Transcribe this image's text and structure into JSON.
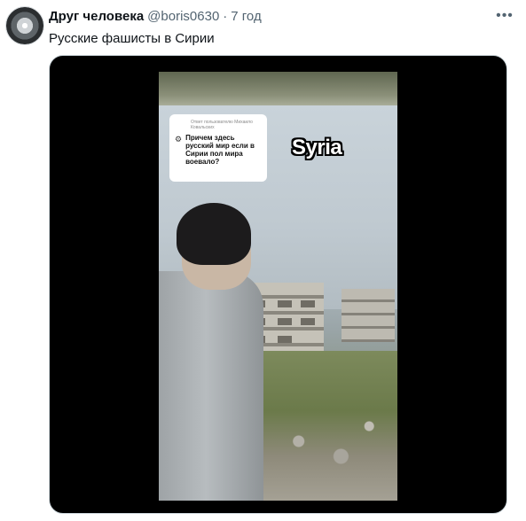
{
  "tweet": {
    "display_name": "Друг человека",
    "handle": "@boris0630",
    "separator": "·",
    "time": "7 год",
    "text": "Русские фашисты в Сирии",
    "more_icon": "more-horizontal-icon"
  },
  "media": {
    "caption": {
      "reply_to": "Ответ пользователю Михаило Ковальских",
      "text": "Причем здесь русский мир если в Сирии пол мира воевало?",
      "icon": "reply-icon"
    },
    "overlay_label": "Syria"
  }
}
